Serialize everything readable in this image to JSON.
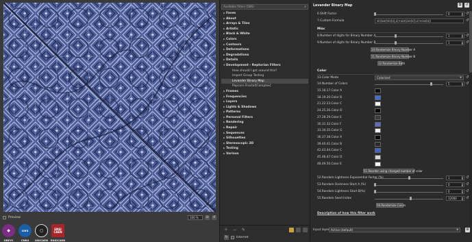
{
  "preview": {
    "checkbox_label": "Preview",
    "zoom": "100 %"
  },
  "logos": [
    {
      "name": "greyc-logo",
      "label": "GREYC",
      "color": "#7a2d82"
    },
    {
      "name": "cnrs-logo",
      "label": "CNRS",
      "color": "#1b5ea8"
    },
    {
      "name": "unicaen-logo",
      "label": "UNICAEN",
      "color": "#222222"
    },
    {
      "name": "ensicaen-logo",
      "label": "ENSICAEN",
      "color": "#a8262a"
    }
  ],
  "tree": {
    "search_text": "Available filters (586)",
    "items": [
      {
        "label": "Faves",
        "type": "folder",
        "open": false,
        "selected": false
      },
      {
        "label": "About",
        "type": "folder",
        "open": false,
        "selected": false
      },
      {
        "label": "Arrays & Tiles",
        "type": "folder",
        "open": false,
        "selected": false
      },
      {
        "label": "Artistic",
        "type": "folder",
        "open": false,
        "selected": false
      },
      {
        "label": "Black & White",
        "type": "folder",
        "open": false,
        "selected": false
      },
      {
        "label": "Colors",
        "type": "folder",
        "open": false,
        "selected": false
      },
      {
        "label": "Contours",
        "type": "folder",
        "open": false,
        "selected": false
      },
      {
        "label": "Deformations",
        "type": "folder",
        "open": false,
        "selected": false
      },
      {
        "label": "Degradations",
        "type": "folder",
        "open": false,
        "selected": false
      },
      {
        "label": "Details",
        "type": "folder",
        "open": false,
        "selected": false
      },
      {
        "label": "Development - Reptorian Filters",
        "type": "folder",
        "open": true,
        "selected": false
      },
      {
        "label": "How should I get around this?",
        "type": "child",
        "open": false,
        "selected": false
      },
      {
        "label": "Import Group Testing",
        "type": "child",
        "open": false,
        "selected": false
      },
      {
        "label": "Levander Binary Map",
        "type": "child",
        "open": false,
        "selected": true
      },
      {
        "label": "Popcorn Fractal[Complex]",
        "type": "child",
        "open": false,
        "selected": false
      },
      {
        "label": "Frames",
        "type": "folder",
        "open": false,
        "selected": false
      },
      {
        "label": "Frequencies",
        "type": "folder",
        "open": false,
        "selected": false
      },
      {
        "label": "Layers",
        "type": "folder",
        "open": false,
        "selected": false
      },
      {
        "label": "Lights & Shadows",
        "type": "folder",
        "open": false,
        "selected": false
      },
      {
        "label": "Patterns",
        "type": "folder",
        "open": false,
        "selected": false
      },
      {
        "label": "Personal Filters",
        "type": "folder",
        "open": false,
        "selected": false
      },
      {
        "label": "Rendering",
        "type": "folder",
        "open": false,
        "selected": false
      },
      {
        "label": "Repair",
        "type": "folder",
        "open": false,
        "selected": false
      },
      {
        "label": "Sequences",
        "type": "folder",
        "open": false,
        "selected": false
      },
      {
        "label": "Silhouettes",
        "type": "folder",
        "open": false,
        "selected": false
      },
      {
        "label": "Stereoscopic 3D",
        "type": "folder",
        "open": false,
        "selected": false
      },
      {
        "label": "Testing",
        "type": "folder",
        "open": false,
        "selected": false
      },
      {
        "label": "Various",
        "type": "folder",
        "open": false,
        "selected": false
      }
    ],
    "internet_label": "Internet"
  },
  "params": {
    "title": "Levander Binary Map",
    "shift_factor": {
      "label": "6.Shift Factor",
      "value": "0",
      "level": 0.0
    },
    "custom_formula": {
      "label": "7.Custom Formula",
      "value": "sin(xor(sin(x),x)+xor(cos(x)),x)+cos(x))"
    },
    "misc_title": "Misc",
    "digits_a": {
      "label": "8.Number of digits for Binary Number A",
      "value": "1",
      "level": 0.3
    },
    "digits_b": {
      "label": "9.Number of digits for Binary Number B",
      "value": "1",
      "level": 0.3
    },
    "btn_rand_a": "10.Randomize Binary Number A",
    "btn_rand_b": "11.Randomize Binary Number B",
    "btn_rand_both": "12.Randomize Both",
    "color_title": "Color",
    "color_mode": {
      "label": "13.Color Mode",
      "value": "Colorized"
    },
    "num_colors": {
      "label": "14.Number of Colors",
      "value": "5",
      "level": 0.82
    },
    "colors": [
      {
        "label": "15.16.17.Color A",
        "color": "#0c0c0c"
      },
      {
        "label": "18.19.20.Color B",
        "color": "#3f6fd6"
      },
      {
        "label": "21.22.23.Color C",
        "color": "#f2f2f2"
      },
      {
        "label": "24.25.26.Color D",
        "color": "#0a0a0a"
      },
      {
        "label": "27.28.29.Color E",
        "color": "#3a3a3a"
      },
      {
        "label": "30.31.32.Color F",
        "color": "#5d6cc4"
      },
      {
        "label": "33.34.35.Color G",
        "color": "#f0f0f0"
      },
      {
        "label": "36.37.38.Color A",
        "color": "#0b0b0b"
      },
      {
        "label": "39.40.41.Color B",
        "color": "#2a2a2a"
      },
      {
        "label": "42.43.44.Color C",
        "color": "#3e64d0"
      },
      {
        "label": "45.46.47.Color D",
        "color": "#d9d9d9"
      },
      {
        "label": "48.49.50.Color E",
        "color": "#f5f5f5"
      }
    ],
    "btn_reorder": "51.Reorder using changed number of color",
    "lightness_factor": {
      "label": "52.Random Lightness Exponential Factor (%)",
      "value": "1",
      "level": 0.5
    },
    "darkness_start": {
      "label": "53.Random Darkness Start A (%)",
      "value": "0",
      "level": 0.0
    },
    "lightness_start": {
      "label": "54.Random Lightness Start B(%)",
      "value": "0",
      "level": 0.0
    },
    "seed_index": {
      "label": "55.Random Seed Index",
      "value": "12000",
      "level": 0.52
    },
    "btn_rand_colors": "56.Randomize Colors",
    "description_link": "Description of how this filter work",
    "input_layers_label": "Input layers",
    "input_layers_value": "Active (default)"
  }
}
